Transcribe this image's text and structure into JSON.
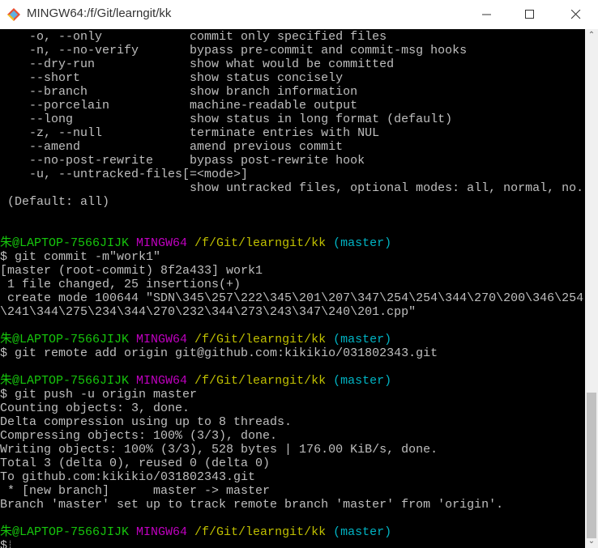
{
  "window": {
    "title": "MINGW64:/f/Git/learngit/kk"
  },
  "colors": {
    "green": "#16c60c",
    "magenta": "#c000c0",
    "yellow": "#c0c000",
    "cyan": "#00b4c4",
    "text": "#bfbfbf"
  },
  "terminal": {
    "lines": [
      [
        {
          "t": "    -o, --only            commit only specified files"
        }
      ],
      [
        {
          "t": "    -n, --no-verify       bypass pre-commit and commit-msg hooks"
        }
      ],
      [
        {
          "t": "    --dry-run             show what would be committed"
        }
      ],
      [
        {
          "t": "    --short               show status concisely"
        }
      ],
      [
        {
          "t": "    --branch              show branch information"
        }
      ],
      [
        {
          "t": "    --porcelain           machine-readable output"
        }
      ],
      [
        {
          "t": "    --long                show status in long format (default)"
        }
      ],
      [
        {
          "t": "    -z, --null            terminate entries with NUL"
        }
      ],
      [
        {
          "t": "    --amend               amend previous commit"
        }
      ],
      [
        {
          "t": "    --no-post-rewrite     bypass post-rewrite hook"
        }
      ],
      [
        {
          "t": "    -u, --untracked-files[=<mode>]"
        }
      ],
      [
        {
          "t": "                          show untracked files, optional modes: all, normal, no."
        }
      ],
      [
        {
          "t": " (Default: all)"
        }
      ],
      [],
      [],
      [
        {
          "t": "朱@LAPTOP-7566JIJK ",
          "c": "green"
        },
        {
          "t": "MINGW64 ",
          "c": "magenta"
        },
        {
          "t": "/f/Git/learngit/kk ",
          "c": "yellow"
        },
        {
          "t": "(master)",
          "c": "cyan"
        }
      ],
      [
        {
          "t": "$ git commit -m\"work1\""
        }
      ],
      [
        {
          "t": "[master (root-commit) 8f2a433] work1"
        }
      ],
      [
        {
          "t": " 1 file changed, 25 insertions(+)"
        }
      ],
      [
        {
          "t": " create mode 100644 \"SDN\\345\\257\\222\\345\\201\\207\\347\\254\\254\\344\\270\\200\\346\\254"
        }
      ],
      [
        {
          "t": "\\241\\344\\275\\234\\344\\270\\232\\344\\273\\243\\347\\240\\201.cpp\""
        }
      ],
      [],
      [
        {
          "t": "朱@LAPTOP-7566JIJK ",
          "c": "green"
        },
        {
          "t": "MINGW64 ",
          "c": "magenta"
        },
        {
          "t": "/f/Git/learngit/kk ",
          "c": "yellow"
        },
        {
          "t": "(master)",
          "c": "cyan"
        }
      ],
      [
        {
          "t": "$ git remote add origin git@github.com:kikikio/031802343.git"
        }
      ],
      [],
      [
        {
          "t": "朱@LAPTOP-7566JIJK ",
          "c": "green"
        },
        {
          "t": "MINGW64 ",
          "c": "magenta"
        },
        {
          "t": "/f/Git/learngit/kk ",
          "c": "yellow"
        },
        {
          "t": "(master)",
          "c": "cyan"
        }
      ],
      [
        {
          "t": "$ git push -u origin master"
        }
      ],
      [
        {
          "t": "Counting objects: 3, done."
        }
      ],
      [
        {
          "t": "Delta compression using up to 8 threads."
        }
      ],
      [
        {
          "t": "Compressing objects: 100% (3/3), done."
        }
      ],
      [
        {
          "t": "Writing objects: 100% (3/3), 528 bytes | 176.00 KiB/s, done."
        }
      ],
      [
        {
          "t": "Total 3 (delta 0), reused 0 (delta 0)"
        }
      ],
      [
        {
          "t": "To github.com:kikikio/031802343.git"
        }
      ],
      [
        {
          "t": " * [new branch]      master -> master"
        }
      ],
      [
        {
          "t": "Branch 'master' set up to track remote branch 'master' from 'origin'."
        }
      ],
      [],
      [
        {
          "t": "朱@LAPTOP-7566JIJK ",
          "c": "green"
        },
        {
          "t": "MINGW64 ",
          "c": "magenta"
        },
        {
          "t": "/f/Git/learngit/kk ",
          "c": "yellow"
        },
        {
          "t": "(master)",
          "c": "cyan"
        }
      ],
      [
        {
          "t": "$"
        }
      ]
    ]
  }
}
